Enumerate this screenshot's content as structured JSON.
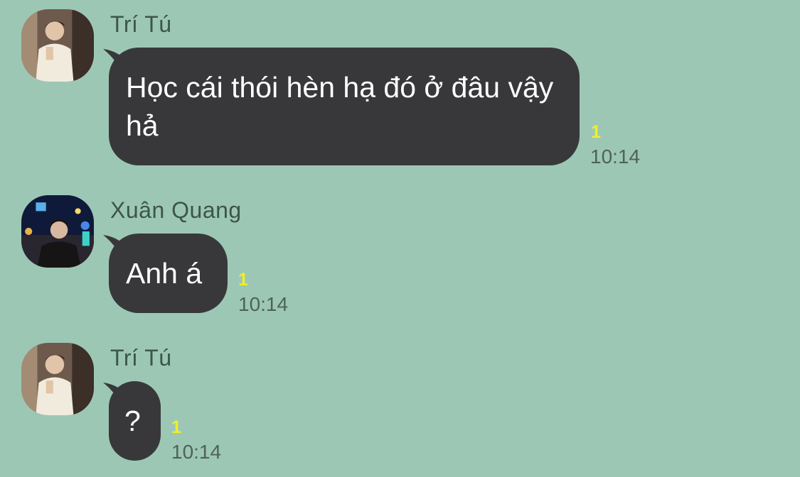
{
  "messages": [
    {
      "sender": "Trí Tú",
      "text": "Học cái thói hèn hạ đó ở đâu vậy hả",
      "read_count": "1",
      "time": "10:14",
      "avatar": "person-white-sweater-avatar"
    },
    {
      "sender": "Xuân Quang",
      "text": "Anh á",
      "read_count": "1",
      "time": "10:14",
      "avatar": "person-night-city-avatar"
    },
    {
      "sender": "Trí Tú",
      "text": "?",
      "read_count": "1",
      "time": "10:14",
      "avatar": "person-white-sweater-avatar"
    }
  ],
  "colors": {
    "background": "#9dc7b5",
    "bubble": "#38383b",
    "bubble_text": "#ffffff",
    "read_marker": "#f2ee2a",
    "meta_text": "#4e6259"
  }
}
